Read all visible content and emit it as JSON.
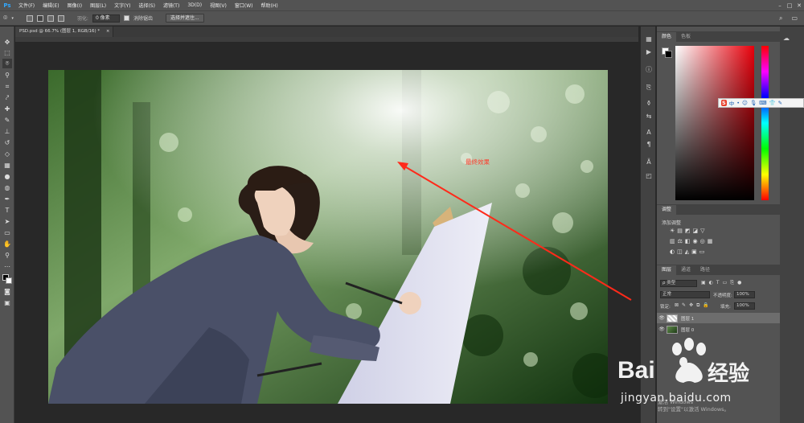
{
  "app": {
    "logo": "Ps"
  },
  "menu": [
    "文件(F)",
    "编辑(E)",
    "图像(I)",
    "图层(L)",
    "文字(Y)",
    "选择(S)",
    "滤镜(T)",
    "3D(D)",
    "视图(V)",
    "窗口(W)",
    "帮助(H)"
  ],
  "window_controls": {
    "minimize": "–",
    "maximize": "□",
    "close": "✕"
  },
  "options": {
    "feather_label": "羽化:",
    "feather_value": "0 像素",
    "antialias_label": "消除锯齿",
    "select_mask_button": "选择并遮住..."
  },
  "document": {
    "tab_title": "PSD.psd @ 66.7% (图层 1, RGB/16) *",
    "close": "×"
  },
  "annotation": {
    "text": "最终效果",
    "color": "#ff2a1a"
  },
  "color_panel": {
    "tabs": [
      "颜色",
      "色板"
    ]
  },
  "adjustments_panel": {
    "tab": "调整",
    "add_label": "添加调整"
  },
  "layers_panel": {
    "tabs": [
      "图层",
      "通道",
      "路径"
    ],
    "kind_filter": "ρ 类型",
    "blend_mode": "正常",
    "opacity_label": "不透明度:",
    "opacity_value": "100%",
    "lock_label": "锁定:",
    "fill_label": "填充:",
    "fill_value": "100%",
    "layers": [
      {
        "name": "图层 1",
        "selected": true
      },
      {
        "name": "图层 0",
        "selected": false
      }
    ]
  },
  "ime_toolbar": {
    "items": [
      "S",
      "中",
      "•",
      "☺",
      "🎙",
      "⌨",
      "👕",
      "✎"
    ]
  },
  "watermark": {
    "brand": "Bai",
    "brand_cn": "经验",
    "url": "jingyan.baidu.com",
    "windows_line1": "激活 Windows",
    "windows_line2": "转到\"设置\"以激活 Windows。"
  },
  "colors": {
    "ui_dark": "#282828",
    "ui_panel": "#535353",
    "accent_blue": "#31a8ff",
    "arrow_red": "#ff2a1a"
  }
}
